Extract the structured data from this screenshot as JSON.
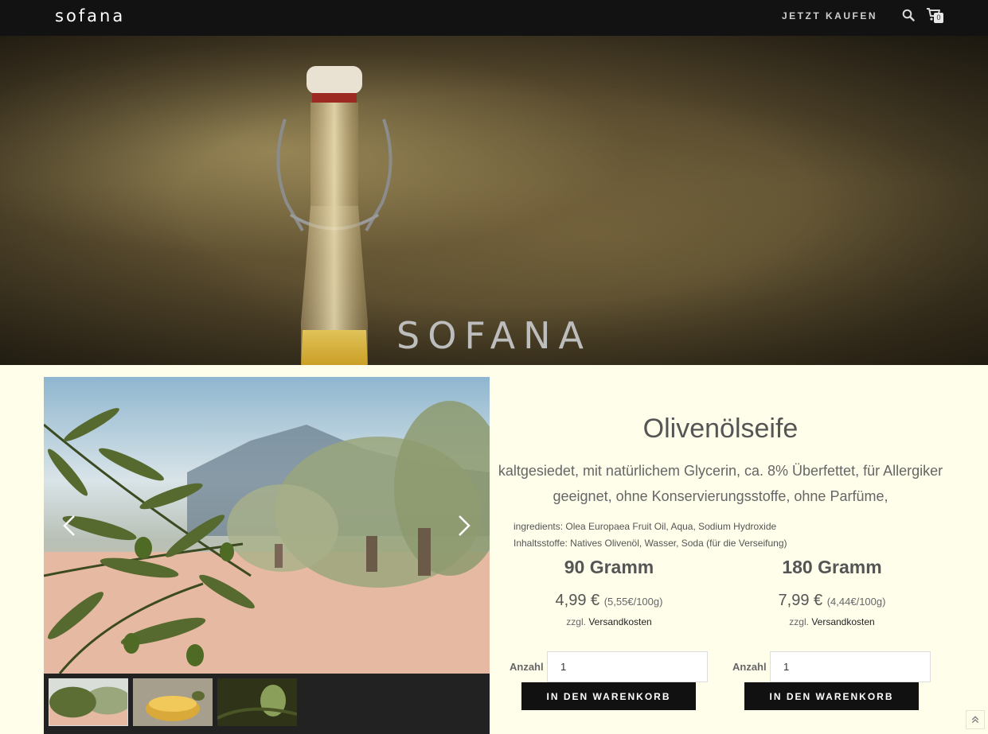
{
  "header": {
    "logo": "sofana",
    "nav_buy": "JETZT KAUFEN",
    "cart_count": "0",
    "search_icon": "search-icon",
    "cart_icon": "shopping-cart-icon"
  },
  "hero": {
    "title": "SOFANA"
  },
  "carousel": {
    "prev_icon": "chevron-left-icon",
    "next_icon": "chevron-right-icon",
    "active_thumb": 0
  },
  "product": {
    "title": "Olivenölseife",
    "description_line1": "kaltgesiedet, mit natürlichem Glycerin, ca. 8% Überfettet, für Allergiker",
    "description_line2": "geeignet, ohne Konservierungsstoffe, ohne Parfüme,",
    "ingredients": "ingredients: Olea Europaea Fruit Oil, Aqua, Sodium Hydroxide",
    "inhaltsstoffe": "Inhaltsstoffe: Natives Olivenöl, Wasser, Soda (für die Verseifung)"
  },
  "variants": [
    {
      "name": "90 Gramm",
      "price": "4,99 €",
      "unit_price": "(5,55€/100g)",
      "shipping_prefix": "zzgl.",
      "shipping_link": "Versandkosten",
      "qty_label": "Anzahl",
      "qty_value": "1",
      "button": "IN DEN WARENKORB"
    },
    {
      "name": "180 Gramm",
      "price": "7,99 €",
      "unit_price": "(4,44€/100g)",
      "shipping_prefix": "zzgl.",
      "shipping_link": "Versandkosten",
      "qty_label": "Anzahl",
      "qty_value": "1",
      "button": "IN DEN WARENKORB"
    }
  ],
  "colors": {
    "page_bg": "#fffeeb",
    "header_bg": "#121212",
    "button_bg": "#111111"
  }
}
